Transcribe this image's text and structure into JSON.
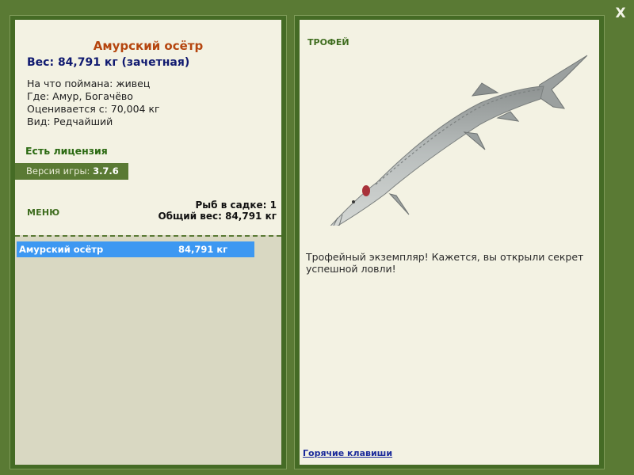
{
  "close_label": "X",
  "fish": {
    "name": "Амурский осётр",
    "weight_line": "Вес: 84,791 кг (зачетная)",
    "bait_line": "На что поймана: живец",
    "location_line": "Где: Амур, Богачёво",
    "rated_line": "Оценивается с: 70,004 кг",
    "type_line": "Вид: Редчайший"
  },
  "license_text": "Есть лицензия",
  "version": {
    "label": "Версия игры:",
    "value": "3.7.6"
  },
  "menu_label": "МЕНЮ",
  "keepnet": {
    "count_line": "Рыб в садке: 1",
    "total_line": "Общий вес: 84,791 кг",
    "items": [
      {
        "name": "Амурский осётр",
        "weight": "84,791 кг"
      }
    ]
  },
  "trophy": {
    "label": "ТРОФЕЙ",
    "message": "Трофейный экземпляр! Кажется, вы открыли секрет успешной ловли!"
  },
  "hotkeys_label": "Горячие клавиши",
  "colors": {
    "frame": "#5a7a34",
    "panel": "#f3f2e3",
    "title": "#b5460f",
    "weight": "#101a70",
    "selection": "#3d98f2"
  }
}
